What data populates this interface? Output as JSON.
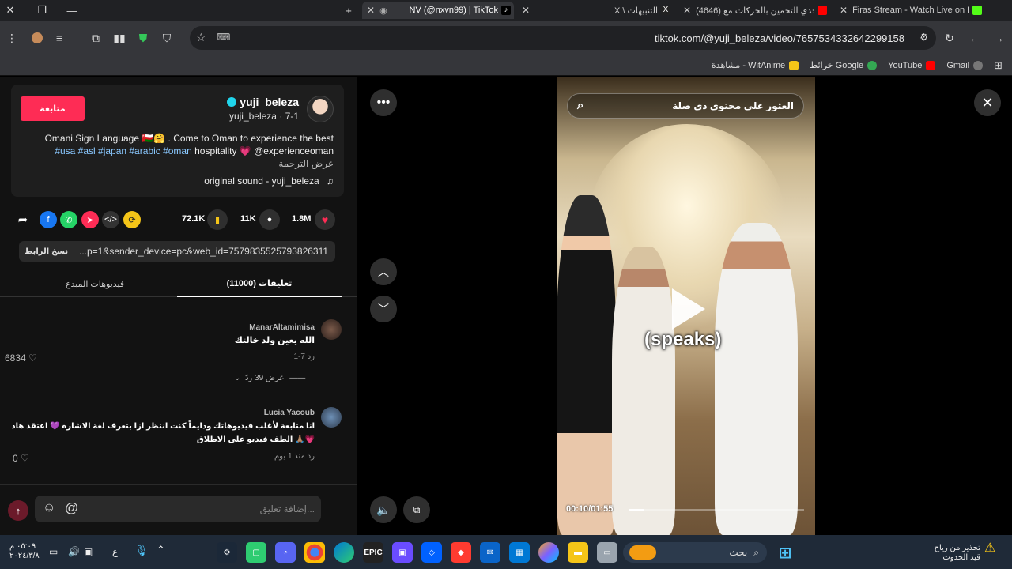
{
  "browser": {
    "tabs": [
      {
        "title": "Firas Stream - Watch Live on Ki",
        "favicon_color": "#53fc18"
      },
      {
        "title": "(4646) تحدي التخمين بالحركات مع",
        "favicon_color": "#ff0000"
      },
      {
        "title": "X \\ التنبيهات",
        "favicon_color": "#ffffff"
      },
      {
        "title": "NV (@nxvn99) | TikTok",
        "favicon_color": "#ffffff",
        "active": true
      }
    ],
    "new_tab_label": "+",
    "url": "tiktok.com/@yuji_beleza/video/7657534332642299158",
    "bookmarks": [
      {
        "label": "Gmail",
        "color": "#ea4335"
      },
      {
        "label": "YouTube",
        "color": "#ff0000"
      },
      {
        "label": "خرائط Google",
        "color": "#34a853"
      },
      {
        "label": "مشاهدة - WitAnime",
        "color": "#f5c518"
      }
    ]
  },
  "video_page": {
    "follow_label": "متابعة",
    "username": "yuji_beleza",
    "handle_line": "yuji_beleza · 7-1",
    "description_line1": "Omani Sign Language 🇴🇲🤗 . Come to Oman to experience the best",
    "description_line2_tags": "#usa #asl #japan #arabic #oman",
    "description_line2_rest": "hospitality 💗 @experienceoman",
    "translate_label": "عرض الترجمة",
    "sound": "original sound - yuji_beleza",
    "likes": "1.8M",
    "comments_count": "11K",
    "saves": "72.1K",
    "copy_link_label": "نسخ الرابط",
    "link_text": "...p=1&sender_device=pc&web_id=7579835525793826311",
    "tab_comments": "تعليقات (11000)",
    "tab_creator_videos": "فيديوهات المبدع",
    "comments": [
      {
        "name": "ManarAltamimisa",
        "text": "الله يعين ولد خالتك",
        "date": "7-1",
        "reply_label": "رد",
        "likes": "6834",
        "view_replies": "عرض 39 ردًا"
      },
      {
        "name": "Lucia Yacoub",
        "text_line1": "انا متابعة لأغلب فيديوهاتك ودايماً كنت انتظر ازا بتعرف لغة الاشارة 💜 اعتقد هاد",
        "text_line2": "الطف فيديو على الاطلاق 🙏🏽💗",
        "date": "منذ 1 يوم",
        "reply_label": "رد",
        "likes": "0"
      }
    ],
    "comment_placeholder": "إضافة تعليق...",
    "mention_symbol": "@"
  },
  "video": {
    "search_text": "العثور على محتوى ذي صلة",
    "caption": "(speaks)",
    "timecode": "00:10/01:55",
    "progress": 0.09
  },
  "taskbar": {
    "search_placeholder": "بحث",
    "weather_line1": "تحذير من رياح",
    "weather_line2": "قيد الحدوث",
    "clock_time": "٠٥:٠٩ م",
    "clock_date": "٢٠٢٤/٣/٨",
    "lang": "ع"
  }
}
